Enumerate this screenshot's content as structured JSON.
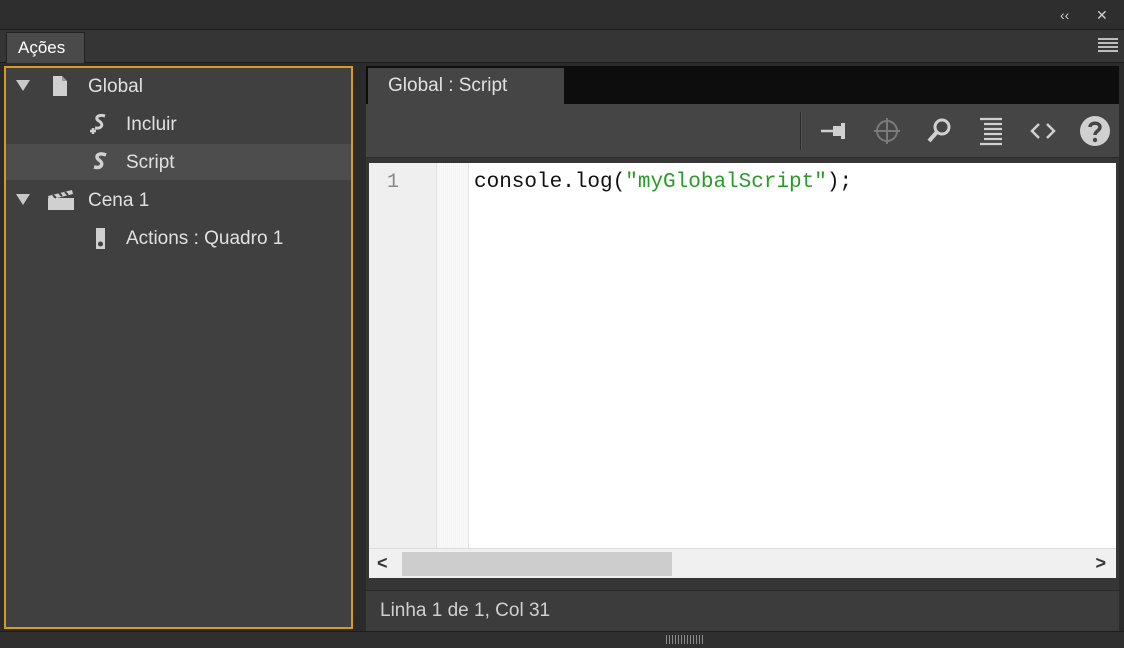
{
  "window": {
    "collapse_label": "‹‹",
    "close_label": "✕"
  },
  "panel": {
    "tab_label": "Ações"
  },
  "tree": {
    "items": [
      {
        "label": "Global",
        "icon": "document-icon"
      },
      {
        "label": "Incluir",
        "icon": "include-script-icon"
      },
      {
        "label": "Script",
        "icon": "script-icon"
      },
      {
        "label": "Cena 1",
        "icon": "scene-clapperboard-icon"
      },
      {
        "label": "Actions : Quadro 1",
        "icon": "frame-icon"
      }
    ],
    "selected": "Script"
  },
  "editor": {
    "tab_label": "Global : Script",
    "toolbar": [
      "pin-icon",
      "target-icon",
      "search-icon",
      "format-icon",
      "code-hint-icon",
      "help-icon"
    ],
    "lines": [
      {
        "number": "1",
        "code_prefix": "console.log(",
        "code_string": "\"myGlobalScript\"",
        "code_suffix": ");"
      }
    ],
    "status": "Linha 1 de 1, Col 31"
  },
  "colors": {
    "focus_border": "#d99b24",
    "string": "#2a9a2a"
  }
}
